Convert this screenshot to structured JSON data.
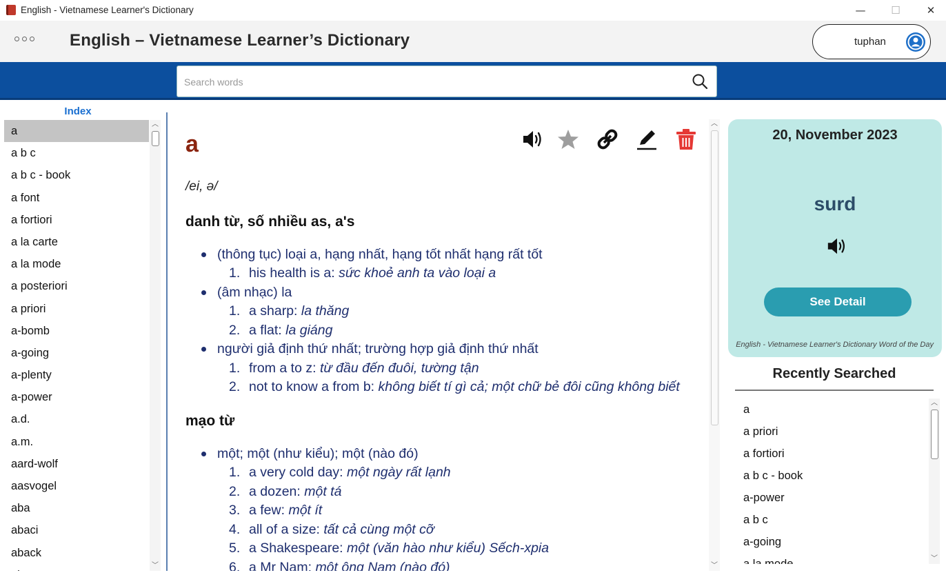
{
  "window": {
    "title": "English - Vietnamese Learner's Dictionary",
    "controls": {
      "minimize": "—",
      "maximize": "☐",
      "close": "✕"
    }
  },
  "header": {
    "app_title": "English – Vietnamese Learner’s Dictionary",
    "user_name": "tuphan"
  },
  "search": {
    "placeholder": "Search words",
    "value": ""
  },
  "index": {
    "title": "Index",
    "selected": "a",
    "items": [
      "a",
      "a b c",
      "a b c - book",
      "a font",
      "a fortiori",
      "a la carte",
      "a la mode",
      "a posteriori",
      "a priori",
      "a-bomb",
      "a-going",
      "a-plenty",
      "a-power",
      "a.d.",
      "a.m.",
      "aard-wolf",
      "aasvogel",
      "aba",
      "abaci",
      "aback",
      "abacus"
    ]
  },
  "entry": {
    "headword": "a",
    "pronunciation": "/ei, ə/",
    "sections": [
      {
        "pos": "danh từ, số nhiều as, a's",
        "senses": [
          {
            "meaning": "(thông tục) loại a, hạng nhất, hạng tốt nhất hạng rất tốt",
            "examples": [
              {
                "en": "his health is a: ",
                "vi": "sức khoẻ anh ta vào loại a"
              }
            ]
          },
          {
            "meaning": "(âm nhạc) la",
            "examples": [
              {
                "en": "a sharp: ",
                "vi": "la thăng"
              },
              {
                "en": "a flat: ",
                "vi": "la giáng"
              }
            ]
          },
          {
            "meaning": "người giả định thứ nhất; trường hợp giả định thứ nhất",
            "examples": [
              {
                "en": "from a to z: ",
                "vi": "từ đầu đến đuôi, tường tận"
              },
              {
                "en": "not to know a from b: ",
                "vi": "không biết tí gì cả; một chữ bẻ đôi cũng không biết"
              }
            ]
          }
        ]
      },
      {
        "pos": "mạo từ",
        "senses": [
          {
            "meaning": "một; một (như kiểu); một (nào đó)",
            "examples": [
              {
                "en": "a very cold day: ",
                "vi": "một ngày rất lạnh"
              },
              {
                "en": "a dozen: ",
                "vi": "một tá"
              },
              {
                "en": "a few: ",
                "vi": "một ít"
              },
              {
                "en": "all of a size: ",
                "vi": "tất cả cùng một cỡ"
              },
              {
                "en": "a Shakespeare: ",
                "vi": "một (văn hào như kiểu) Sếch-xpia"
              },
              {
                "en": "a Mr Nam: ",
                "vi": "một ông Nam (nào đó)"
              }
            ]
          }
        ]
      }
    ],
    "icons": [
      "speaker-icon",
      "star-icon",
      "link-icon",
      "pencil-icon",
      "trash-icon"
    ],
    "colors": {
      "headword": "#8b2510",
      "delete": "#e53935",
      "star": "#9e9e9e"
    }
  },
  "word_of_day": {
    "date": "20, November 2023",
    "word": "surd",
    "button_label": "See Detail",
    "caption": "English - Vietnamese Learner's Dictionary Word of the Day"
  },
  "recent": {
    "title": "Recently Searched",
    "items": [
      "a",
      "a priori",
      "a fortiori",
      "a b c - book",
      "a-power",
      "a b c",
      "a-going",
      "a la mode"
    ]
  },
  "colors": {
    "brand": "#0c4f9e",
    "accent": "#2a9db0",
    "card": "#bfe9e6"
  }
}
